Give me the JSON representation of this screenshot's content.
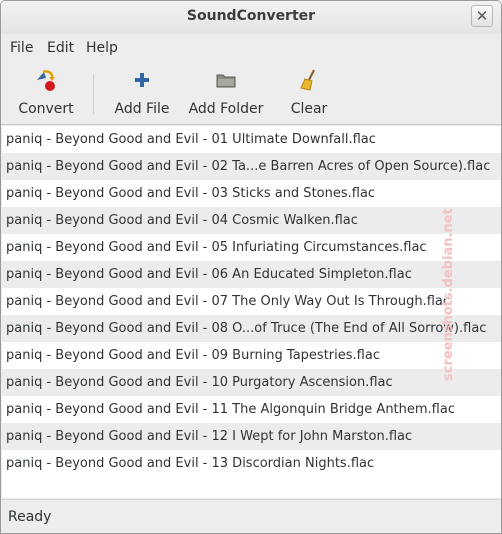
{
  "window": {
    "title": "SoundConverter"
  },
  "menubar": {
    "items": [
      "File",
      "Edit",
      "Help"
    ]
  },
  "toolbar": {
    "convert_label": "Convert",
    "add_file_label": "Add File",
    "add_folder_label": "Add Folder",
    "clear_label": "Clear"
  },
  "files": [
    "paniq - Beyond Good and Evil - 01 Ultimate Downfall.flac",
    "paniq - Beyond Good and Evil - 02 Ta...e Barren Acres of Open Source).flac",
    "paniq - Beyond Good and Evil - 03 Sticks and Stones.flac",
    "paniq - Beyond Good and Evil - 04 Cosmic Walken.flac",
    "paniq - Beyond Good and Evil - 05 Infuriating Circumstances.flac",
    "paniq - Beyond Good and Evil - 06 An Educated Simpleton.flac",
    "paniq - Beyond Good and Evil - 07 The Only Way Out Is Through.flac",
    "paniq - Beyond Good and Evil - 08 O...of Truce (The End of All Sorrow).flac",
    "paniq - Beyond Good and Evil - 09 Burning Tapestries.flac",
    "paniq - Beyond Good and Evil - 10 Purgatory Ascension.flac",
    "paniq - Beyond Good and Evil - 11 The Algonquin Bridge Anthem.flac",
    "paniq - Beyond Good and Evil - 12 I Wept for John Marston.flac",
    "paniq - Beyond Good and Evil - 13 Discordian Nights.flac"
  ],
  "statusbar": {
    "text": "Ready"
  },
  "watermark": "screenshots.debian.net",
  "icons": {
    "convert": "convert-icon",
    "add_file": "plus-icon",
    "add_folder": "folder-icon",
    "clear": "broom-icon",
    "close": "close-icon"
  },
  "colors": {
    "accent_red": "#d11a1a",
    "accent_blue": "#3465a4",
    "row_alt": "#ececec"
  }
}
